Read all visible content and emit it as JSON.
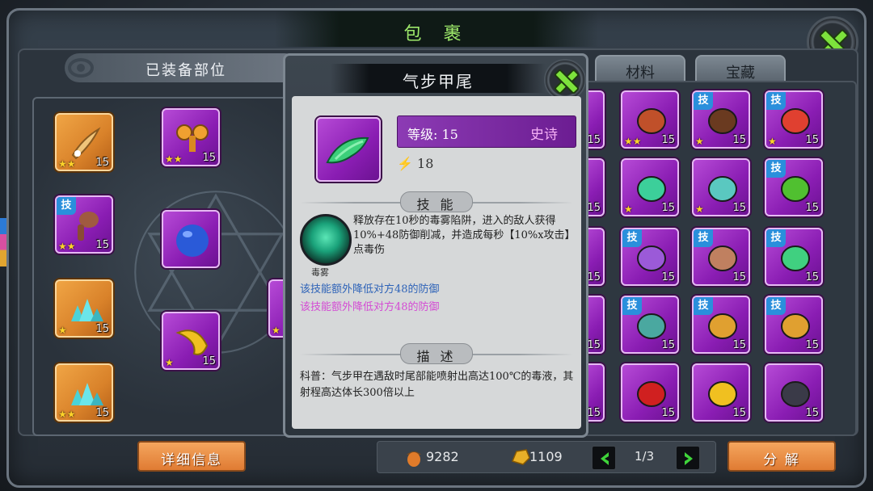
{
  "window": {
    "title": "包 裹"
  },
  "left_panel": {
    "header": "已装备部位"
  },
  "tabs": [
    {
      "label": "材料"
    },
    {
      "label": "宝藏"
    }
  ],
  "equipped_slots": [
    {
      "stars": "★★",
      "level": "15",
      "skill": "",
      "icon": "bone-tail-icon"
    },
    {
      "stars": "★★",
      "level": "15",
      "skill": "",
      "icon": "ribbon-icon"
    },
    {
      "stars": "★★",
      "level": "15",
      "skill": "技",
      "icon": "drumstick-icon"
    },
    {
      "stars": "",
      "level": "",
      "skill": "",
      "icon": "blue-orb-icon"
    },
    {
      "stars": "★",
      "level": "15",
      "skill": "",
      "icon": "crystal-icon"
    },
    {
      "stars": "★",
      "level": "15",
      "skill": "",
      "icon": "yellow-claw-icon"
    },
    {
      "stars": "★★",
      "level": "15",
      "skill": "",
      "icon": "crystal-icon"
    }
  ],
  "grid_items": [
    {
      "stars": "★★",
      "level": "15",
      "skill": "",
      "icon": "eye-creature-icon"
    },
    {
      "stars": "★",
      "level": "15",
      "skill": "技",
      "icon": "cannon-icon"
    },
    {
      "stars": "★",
      "level": "15",
      "skill": "技",
      "icon": "flame-fist-icon"
    },
    {
      "stars": "★",
      "level": "15",
      "skill": "",
      "icon": "green-tail-icon"
    },
    {
      "stars": "★",
      "level": "15",
      "skill": "",
      "icon": "cyan-claw-icon"
    },
    {
      "stars": "",
      "level": "15",
      "skill": "技",
      "icon": "green-leaf-icon"
    },
    {
      "stars": "",
      "level": "15",
      "skill": "技",
      "icon": "purple-tail-icon"
    },
    {
      "stars": "",
      "level": "15",
      "skill": "技",
      "icon": "antler-icon"
    },
    {
      "stars": "",
      "level": "15",
      "skill": "技",
      "icon": "green-wing-icon"
    },
    {
      "stars": "",
      "level": "15",
      "skill": "技",
      "icon": "teal-head-icon"
    },
    {
      "stars": "",
      "level": "15",
      "skill": "技",
      "icon": "gourd-icon"
    },
    {
      "stars": "",
      "level": "15",
      "skill": "技",
      "icon": "gourd-icon"
    },
    {
      "stars": "",
      "level": "15",
      "skill": "",
      "icon": "red-shell-icon"
    },
    {
      "stars": "",
      "level": "15",
      "skill": "",
      "icon": "yellow-leg-icon"
    },
    {
      "stars": "",
      "level": "15",
      "skill": "",
      "icon": "dark-rock-icon"
    }
  ],
  "partial_column_levels": [
    "15",
    "15",
    "15",
    "15",
    "15"
  ],
  "left_partial": {
    "level": "15",
    "stars": "★"
  },
  "popup": {
    "title": "气步甲尾",
    "level_label": "等级: 15",
    "rarity": "史诗",
    "energy": "18",
    "skill_header": "技 能",
    "skill_name": "毒雾",
    "skill_desc": "释放存在10秒的毒雾陷阱，进入的敌人获得10%+48防御削减，并造成每秒【10%x攻击】点毒伤",
    "note_blue": "该技能额外降低对方48的防御",
    "note_pink": "该技能额外降低对方48的防御",
    "desc_header": "描 述",
    "desc_text": "科普：气步甲在遇敌时尾部能喷射出高达100℃的毒液，其射程高达体长300倍以上"
  },
  "buttons": {
    "details": "详细信息",
    "decompose": "分 解"
  },
  "resources": {
    "acorn": "9282",
    "gold": "1109"
  },
  "pagination": {
    "page": "1/3"
  },
  "colors": {
    "accent_green": "#7de23c",
    "epic_purple": "#8a1db3",
    "button_orange": "#e07b33"
  }
}
